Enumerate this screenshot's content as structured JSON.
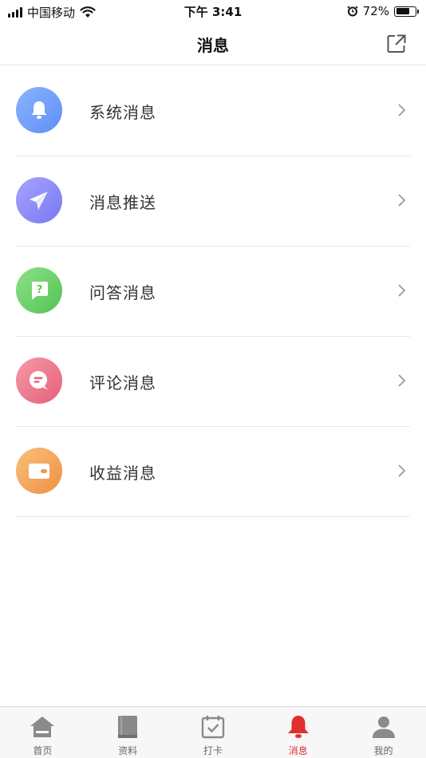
{
  "status_bar": {
    "carrier": "中国移动",
    "time": "下午 3:41",
    "battery_percent": "72%",
    "battery_level": 0.72
  },
  "header": {
    "title": "消息",
    "share_icon": "share-icon"
  },
  "message_list": [
    {
      "label": "系统消息",
      "icon": "bell-icon",
      "color_from": "#8ab4ff",
      "color_to": "#5e8ff5"
    },
    {
      "label": "消息推送",
      "icon": "paper-plane-icon",
      "color_from": "#a7a4ff",
      "color_to": "#7878f2"
    },
    {
      "label": "问答消息",
      "icon": "question-bubble-icon",
      "color_from": "#8ee08a",
      "color_to": "#52c452"
    },
    {
      "label": "评论消息",
      "icon": "comment-icon",
      "color_from": "#f49aa8",
      "color_to": "#e6607a"
    },
    {
      "label": "收益消息",
      "icon": "wallet-icon",
      "color_from": "#f9c07a",
      "color_to": "#ef9045"
    }
  ],
  "tabbar": {
    "tabs": [
      {
        "label": "首页",
        "icon": "home-icon",
        "active": false
      },
      {
        "label": "资料",
        "icon": "book-icon",
        "active": false
      },
      {
        "label": "打卡",
        "icon": "calendar-check-icon",
        "active": false
      },
      {
        "label": "消息",
        "icon": "bell-icon",
        "active": true
      },
      {
        "label": "我的",
        "icon": "person-icon",
        "active": false
      }
    ],
    "active_color": "#e0302d",
    "inactive_color": "#8a8a8a"
  }
}
